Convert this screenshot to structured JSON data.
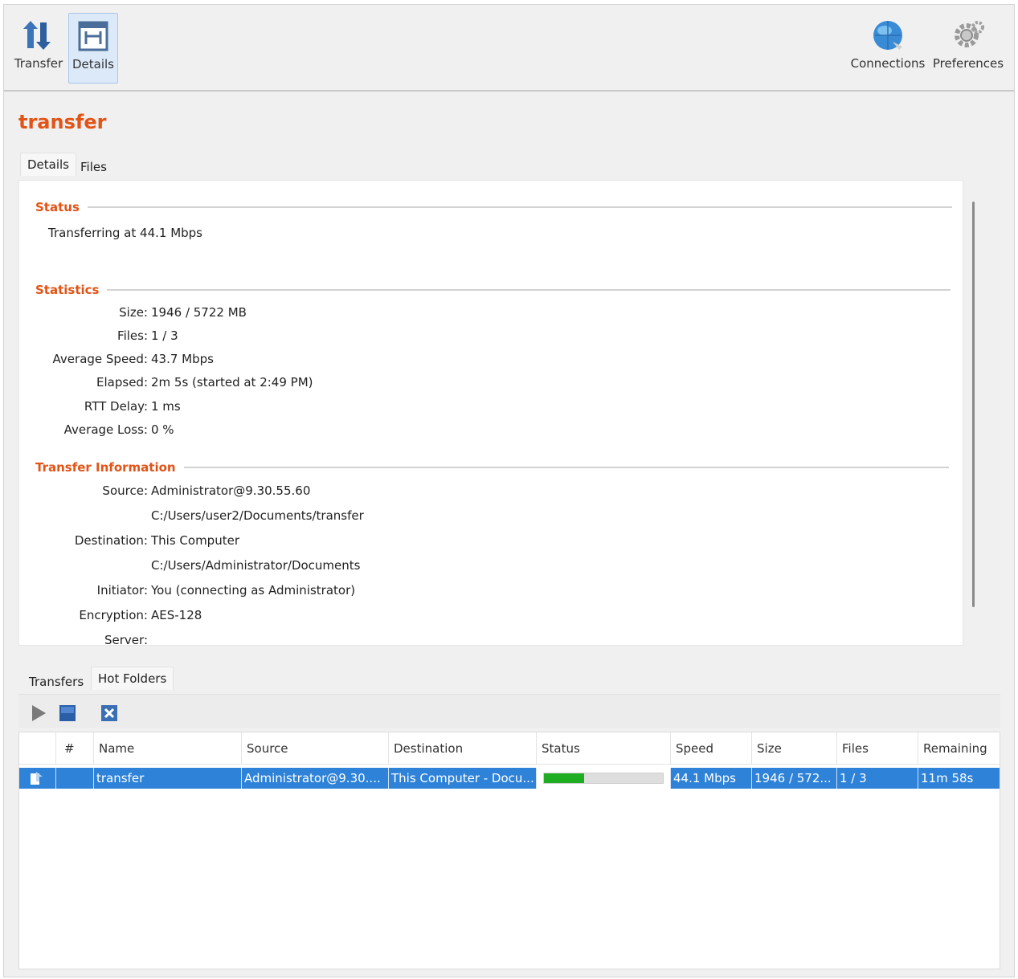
{
  "toolbar": {
    "transfer_label": "Transfer",
    "details_label": "Details",
    "connections_label": "Connections",
    "preferences_label": "Preferences",
    "transfer_icon": "transfer-arrows-icon",
    "details_icon": "details-icon",
    "connections_icon": "globe-icon",
    "preferences_icon": "gear-icon"
  },
  "title": "transfer",
  "detail_tabs": [
    {
      "label": "Details",
      "active": true
    },
    {
      "label": "Files",
      "active": false
    }
  ],
  "status": {
    "heading": "Status",
    "text": "Transferring at 44.1 Mbps"
  },
  "statistics": {
    "heading": "Statistics",
    "rows": [
      {
        "label": "Size:",
        "value": "1946 / 5722 MB"
      },
      {
        "label": "Files:",
        "value": "1 / 3"
      },
      {
        "label": "Average Speed:",
        "value": "43.7 Mbps"
      },
      {
        "label": "Elapsed:",
        "value": "2m 5s (started at 2:49 PM)"
      },
      {
        "label": "RTT Delay:",
        "value": "1 ms"
      },
      {
        "label": "Average Loss:",
        "value": "0 %"
      }
    ]
  },
  "transfer_info": {
    "heading": "Transfer Information",
    "rows": [
      {
        "label": "Source:",
        "value": "Administrator@9.30.55.60"
      },
      {
        "label": "",
        "value": "C:/Users/user2/Documents/transfer"
      },
      {
        "label": "Destination:",
        "value": "This Computer"
      },
      {
        "label": "",
        "value": "C:/Users/Administrator/Documents"
      },
      {
        "label": "Initiator:",
        "value": "You (connecting as Administrator)"
      },
      {
        "label": "Encryption:",
        "value": "AES-128"
      },
      {
        "label": "Server:",
        "value": ""
      }
    ]
  },
  "bottom_tabs": [
    {
      "label": "Transfers",
      "active": false
    },
    {
      "label": "Hot Folders",
      "active": true
    }
  ],
  "table": {
    "columns": [
      "",
      "#",
      "Name",
      "Source",
      "Destination",
      "Status",
      "Speed",
      "Size",
      "Files",
      "Remaining"
    ],
    "rows": [
      {
        "icon": "transfer-row-icon",
        "num": "",
        "name": "transfer",
        "source": "Administrator@9.30....",
        "destination": "This Computer - Docu...",
        "progress": 0.34,
        "speed": "44.1 Mbps",
        "size": "1946 / 572...",
        "files": "1 / 3",
        "remaining": "11m 58s",
        "selected": true
      }
    ]
  },
  "colors": {
    "accent": "#e25316",
    "selection": "#2e82d8",
    "progress": "#1fae22"
  }
}
